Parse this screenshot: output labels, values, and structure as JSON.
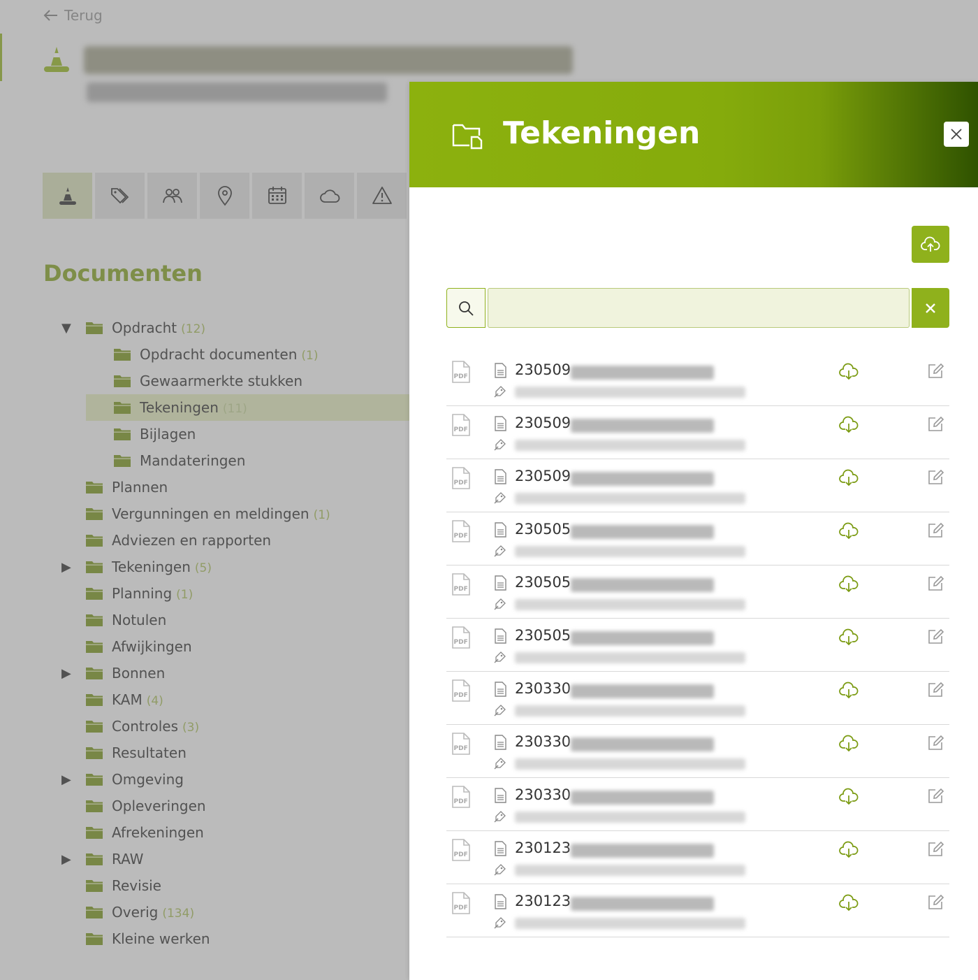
{
  "back": {
    "label": "Terug"
  },
  "icon_bar": [
    {
      "icon": "traffic-cone-icon",
      "active": true
    },
    {
      "icon": "tags-icon"
    },
    {
      "icon": "users-icon"
    },
    {
      "icon": "location-pin-icon"
    },
    {
      "icon": "calendar-icon"
    },
    {
      "icon": "cloud-icon"
    },
    {
      "icon": "warning-icon"
    }
  ],
  "documents": {
    "title": "Documenten",
    "tree": [
      {
        "label": "Opdracht",
        "count": "(12)",
        "level": 0,
        "expander": "▼"
      },
      {
        "label": "Opdracht documenten",
        "count": "(1)",
        "level": 1
      },
      {
        "label": "Gewaarmerkte stukken",
        "count": "",
        "level": 1
      },
      {
        "label": "Tekeningen",
        "count": "(11)",
        "level": 1,
        "selected": true
      },
      {
        "label": "Bijlagen",
        "count": "",
        "level": 1
      },
      {
        "label": "Mandateringen",
        "count": "",
        "level": 1
      },
      {
        "label": "Plannen",
        "count": "",
        "level": 0
      },
      {
        "label": "Vergunningen en meldingen",
        "count": "(1)",
        "level": 0
      },
      {
        "label": "Adviezen en rapporten",
        "count": "",
        "level": 0
      },
      {
        "label": "Tekeningen",
        "count": "(5)",
        "level": 0,
        "expander": "▶"
      },
      {
        "label": "Planning",
        "count": "(1)",
        "level": 0
      },
      {
        "label": "Notulen",
        "count": "",
        "level": 0
      },
      {
        "label": "Afwijkingen",
        "count": "",
        "level": 0
      },
      {
        "label": "Bonnen",
        "count": "",
        "level": 0,
        "expander": "▶"
      },
      {
        "label": "KAM",
        "count": "(4)",
        "level": 0
      },
      {
        "label": "Controles",
        "count": "(3)",
        "level": 0
      },
      {
        "label": "Resultaten",
        "count": "",
        "level": 0
      },
      {
        "label": "Omgeving",
        "count": "",
        "level": 0,
        "expander": "▶"
      },
      {
        "label": "Opleveringen",
        "count": "",
        "level": 0
      },
      {
        "label": "Afrekeningen",
        "count": "",
        "level": 0
      },
      {
        "label": "RAW",
        "count": "",
        "level": 0,
        "expander": "▶"
      },
      {
        "label": "Revisie",
        "count": "",
        "level": 0
      },
      {
        "label": "Overig",
        "count": "(134)",
        "level": 0
      },
      {
        "label": "Kleine werken",
        "count": "",
        "level": 0
      }
    ]
  },
  "panel": {
    "title": "Tekeningen",
    "search": {
      "value": "",
      "placeholder": ""
    },
    "files": [
      {
        "number": "230509"
      },
      {
        "number": "230509"
      },
      {
        "number": "230509"
      },
      {
        "number": "230505"
      },
      {
        "number": "230505"
      },
      {
        "number": "230505"
      },
      {
        "number": "230330"
      },
      {
        "number": "230330"
      },
      {
        "number": "230330"
      },
      {
        "number": "230123"
      },
      {
        "number": "230123"
      }
    ]
  },
  "colors": {
    "accent": "#8cb10e",
    "accent_dark": "#2f5200",
    "folder": "#6f8c0a",
    "count": "#a0b64c"
  }
}
